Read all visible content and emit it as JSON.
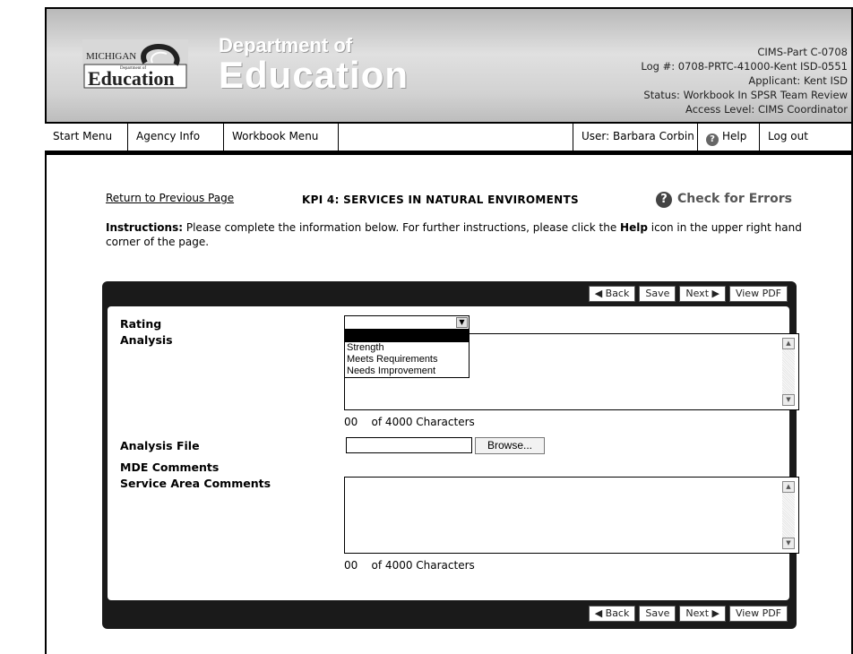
{
  "header": {
    "logo_text_top": "MICHIGAN",
    "logo_text_small": "Department of",
    "logo_text_main": "Education",
    "dept_line1": "Department of",
    "dept_line2": "Education",
    "info": [
      "CIMS-Part C-0708",
      "Log #: 0708-PRTC-41000-Kent ISD-0551",
      "Applicant: Kent ISD",
      "Status: Workbook In SPSR Team Review",
      "Access Level: CIMS Coordinator"
    ]
  },
  "nav": {
    "start_menu": "Start Menu",
    "agency_info": "Agency Info",
    "workbook_menu": "Workbook Menu",
    "user": "User: Barbara Corbin",
    "help": "Help",
    "logout": "Log out"
  },
  "page": {
    "return_link": "Return to Previous Page",
    "title": "KPI 4: SERVICES IN NATURAL ENVIROMENTS",
    "check_errors": "Check for Errors",
    "instructions_label": "Instructions:",
    "instructions_text1": " Please complete the information below.  For further instructions, please click the ",
    "instructions_help": "Help",
    "instructions_text2": " icon in the upper right hand corner of the page."
  },
  "buttons": {
    "back": "◀ Back",
    "save": "Save",
    "next": "Next ▶",
    "view_pdf": "View PDF"
  },
  "form": {
    "rating_label": "Rating",
    "rating_value": "",
    "rating_options": [
      "",
      "Strength",
      "Meets Requirements",
      "Needs Improvement"
    ],
    "analysis_label": "Analysis",
    "analysis_count": "00",
    "analysis_count_suffix": "of 4000 Characters",
    "analysis_file_label": "Analysis File",
    "browse_label": "Browse...",
    "mde_comments_label": "MDE Comments",
    "service_area_label": "Service Area Comments",
    "service_count": "00",
    "service_count_suffix": "of 4000 Characters"
  }
}
